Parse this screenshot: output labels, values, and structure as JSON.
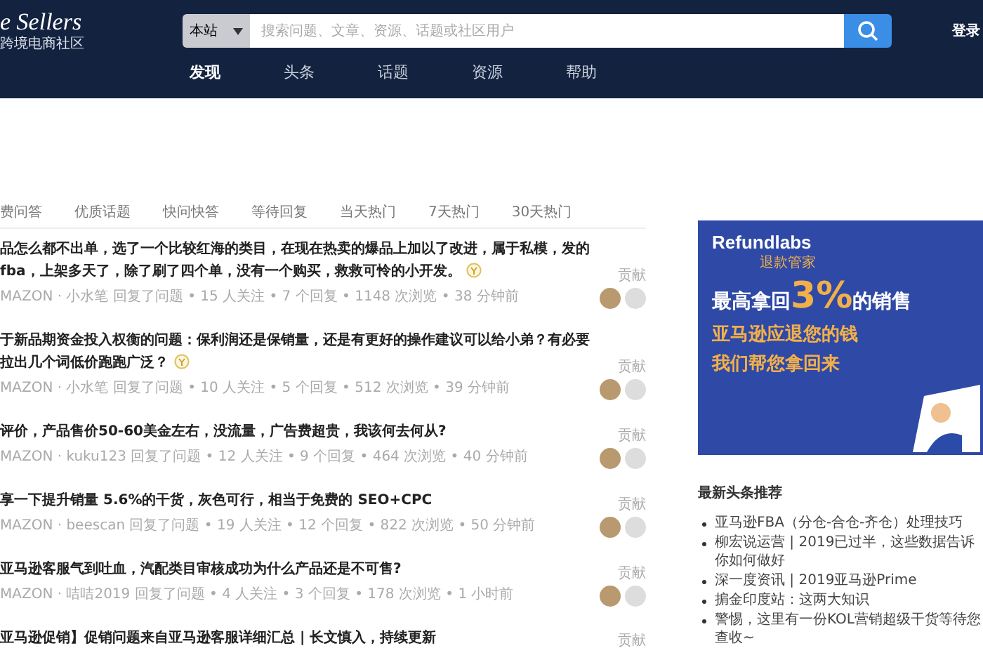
{
  "header": {
    "logo_title": "e Sellers",
    "logo_subtitle": "跨境电商社区",
    "search": {
      "scope": "本站",
      "placeholder": "搜索问题、文章、资源、话题或社区用户"
    },
    "login": "登录",
    "nav": [
      {
        "label": "发现",
        "selected": true
      },
      {
        "label": "头条",
        "selected": false
      },
      {
        "label": "话题",
        "selected": false
      },
      {
        "label": "资源",
        "selected": false
      },
      {
        "label": "帮助",
        "selected": false
      }
    ]
  },
  "tabs": [
    {
      "label": "费问答",
      "selected": false
    },
    {
      "label": "优质话题",
      "selected": false
    },
    {
      "label": "快问快答",
      "selected": false
    },
    {
      "label": "等待回复",
      "selected": false
    },
    {
      "label": "当天热门",
      "selected": false
    },
    {
      "label": "7天热门",
      "selected": false
    },
    {
      "label": "30天热门",
      "selected": false
    }
  ],
  "questions": [
    {
      "title": "品怎么都不出单，选了一个比较红海的类目，在现在热卖的爆品上加以了改进，属于私模，发的fba，上架多天了，除了刷了四个单，没有一个购买，救救可怜的小开发。",
      "reward": true,
      "meta": "MAZON · 小水笔 回复了问题 • 15 人关注 • 7 个回复 • 1148 次浏览 • 38 分钟前",
      "contrib": "贡献"
    },
    {
      "title": "于新品期资金投入权衡的问题：保利润还是保销量，还是有更好的操作建议可以给小弟？有必要拉出几个词低价跑跑广泛？",
      "reward": true,
      "meta": "MAZON · 小水笔 回复了问题 • 10 人关注 • 5 个回复 • 512 次浏览 • 39 分钟前",
      "contrib": "贡献"
    },
    {
      "title": "评价，产品售价50-60美金左右，没流量，广告费超贵，我该何去何从?",
      "reward": false,
      "meta": "MAZON · kuku123 回复了问题 • 12 人关注 • 9 个回复 • 464 次浏览 • 40 分钟前",
      "contrib": "贡献"
    },
    {
      "title": "享一下提升销量 5.6%的干货，灰色可行，相当于免费的 SEO+CPC",
      "reward": false,
      "meta": "MAZON · beescan 回复了问题 • 19 人关注 • 12 个回复 • 822 次浏览 • 50 分钟前",
      "contrib": "贡献"
    },
    {
      "title": "亚马逊客服气到吐血，汽配类目审核成功为什么产品还是不可售?",
      "reward": false,
      "meta": "MAZON · 咭咭2019 回复了问题 • 4 人关注 • 3 个回复 • 178 次浏览 • 1 小时前",
      "contrib": "贡献"
    },
    {
      "title": "亚马逊促销】促销问题来自亚马逊客服详细汇总 | 长文慎入，持续更新",
      "reward": false,
      "contrib": "贡献"
    }
  ],
  "ad": {
    "brand": "Refundlabs",
    "brand_sub": "退款管家",
    "headline_pre": "最高拿回",
    "headline_big": "3%",
    "headline_post": "的销售",
    "line1": "亚马逊应退您的钱",
    "line2": "我们帮您拿回来"
  },
  "news": {
    "title": "最新头条推荐",
    "items": [
      "亚马逊FBA（分仓-合仓-齐仓）处理技巧",
      "柳宏说运营 | 2019已过半，这些数据告诉你如何做好",
      "深一度资讯 | 2019亚马逊Prime",
      "掮金印度站：这两大知识",
      "警惕，这里有一份KOL营销超级干货等待您查收~"
    ]
  }
}
